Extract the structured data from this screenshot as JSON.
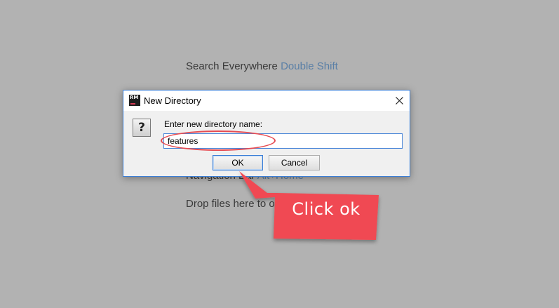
{
  "background": {
    "search_label": "Search Everywhere",
    "search_shortcut": "Double Shift",
    "nav_label": "Navigation Bar",
    "nav_shortcut": "Alt+Home",
    "drop_label": "Drop files here to open"
  },
  "dialog": {
    "title": "New Directory",
    "app_icon_text": "RM",
    "prompt": "Enter new directory name:",
    "input_value": "features",
    "ok_label": "OK",
    "cancel_label": "Cancel",
    "close_glyph": "✕",
    "question_glyph": "?"
  },
  "annotation": {
    "callout_text": "Click ok",
    "accent_color": "#f04a52"
  },
  "icons": [
    "app-icon",
    "close-icon",
    "question-icon"
  ]
}
